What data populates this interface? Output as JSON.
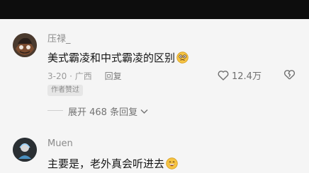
{
  "comments": [
    {
      "username": "压禄_",
      "text": "美式霸凌和中式霸凌的区别",
      "date": "3-20",
      "location": "广西",
      "reply_label": "回复",
      "likes": "12.4万",
      "author_liked": "作者赞过",
      "expand_label": "展开 468 条回复",
      "emoji": "thinking-face-icon"
    },
    {
      "username": "Muen",
      "text": "主要是，老外真会听进去",
      "emoji": "grinning-face-icon"
    }
  ],
  "colors": {
    "top_bar": "#0d0d0d",
    "background": "#f5f5f5",
    "text": "#161616",
    "secondary": "#9a9a9a"
  }
}
